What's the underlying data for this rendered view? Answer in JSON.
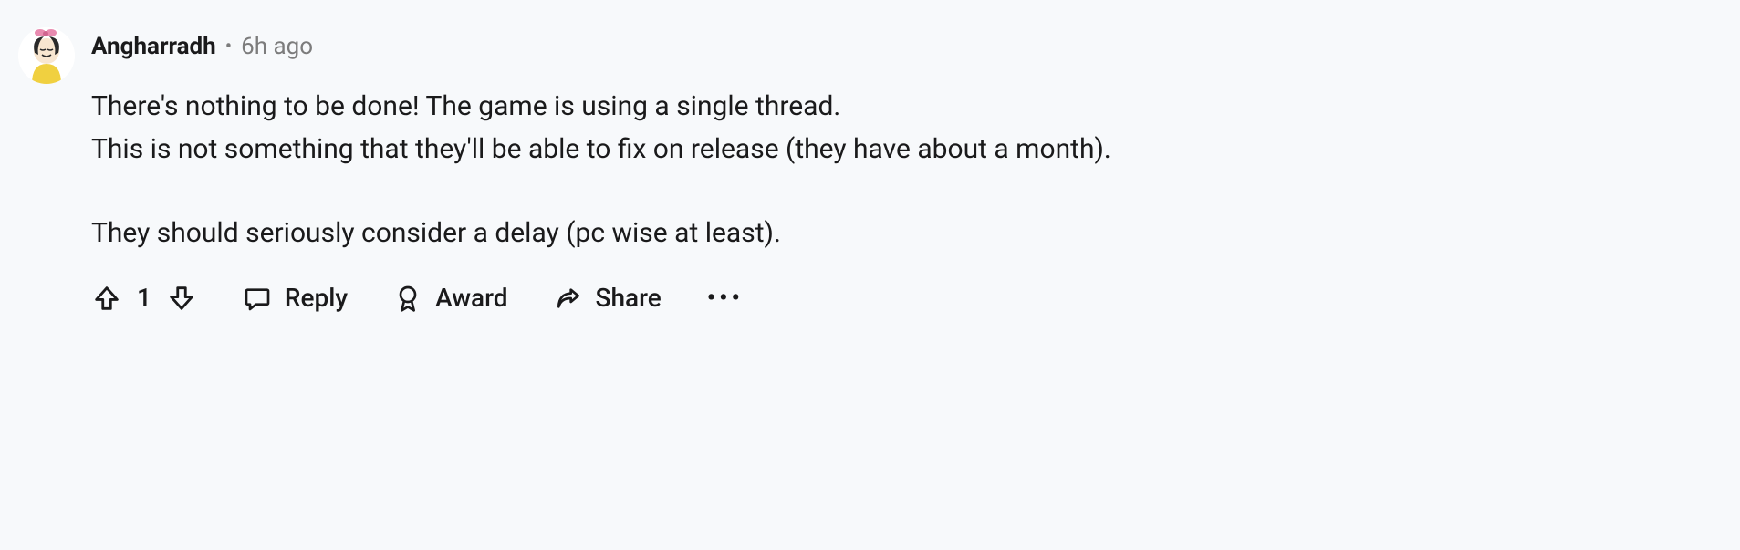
{
  "comment": {
    "username": "Angharradh",
    "timestamp": "6h ago",
    "body_line1": "There's nothing to be done! The game is using a single thread.",
    "body_line2": "This is not something that they'll be able to fix on release (they have about a month).",
    "body_line3": "They should seriously consider a delay (pc wise at least).",
    "score": "1"
  },
  "actions": {
    "reply": "Reply",
    "award": "Award",
    "share": "Share",
    "more": "•••"
  }
}
